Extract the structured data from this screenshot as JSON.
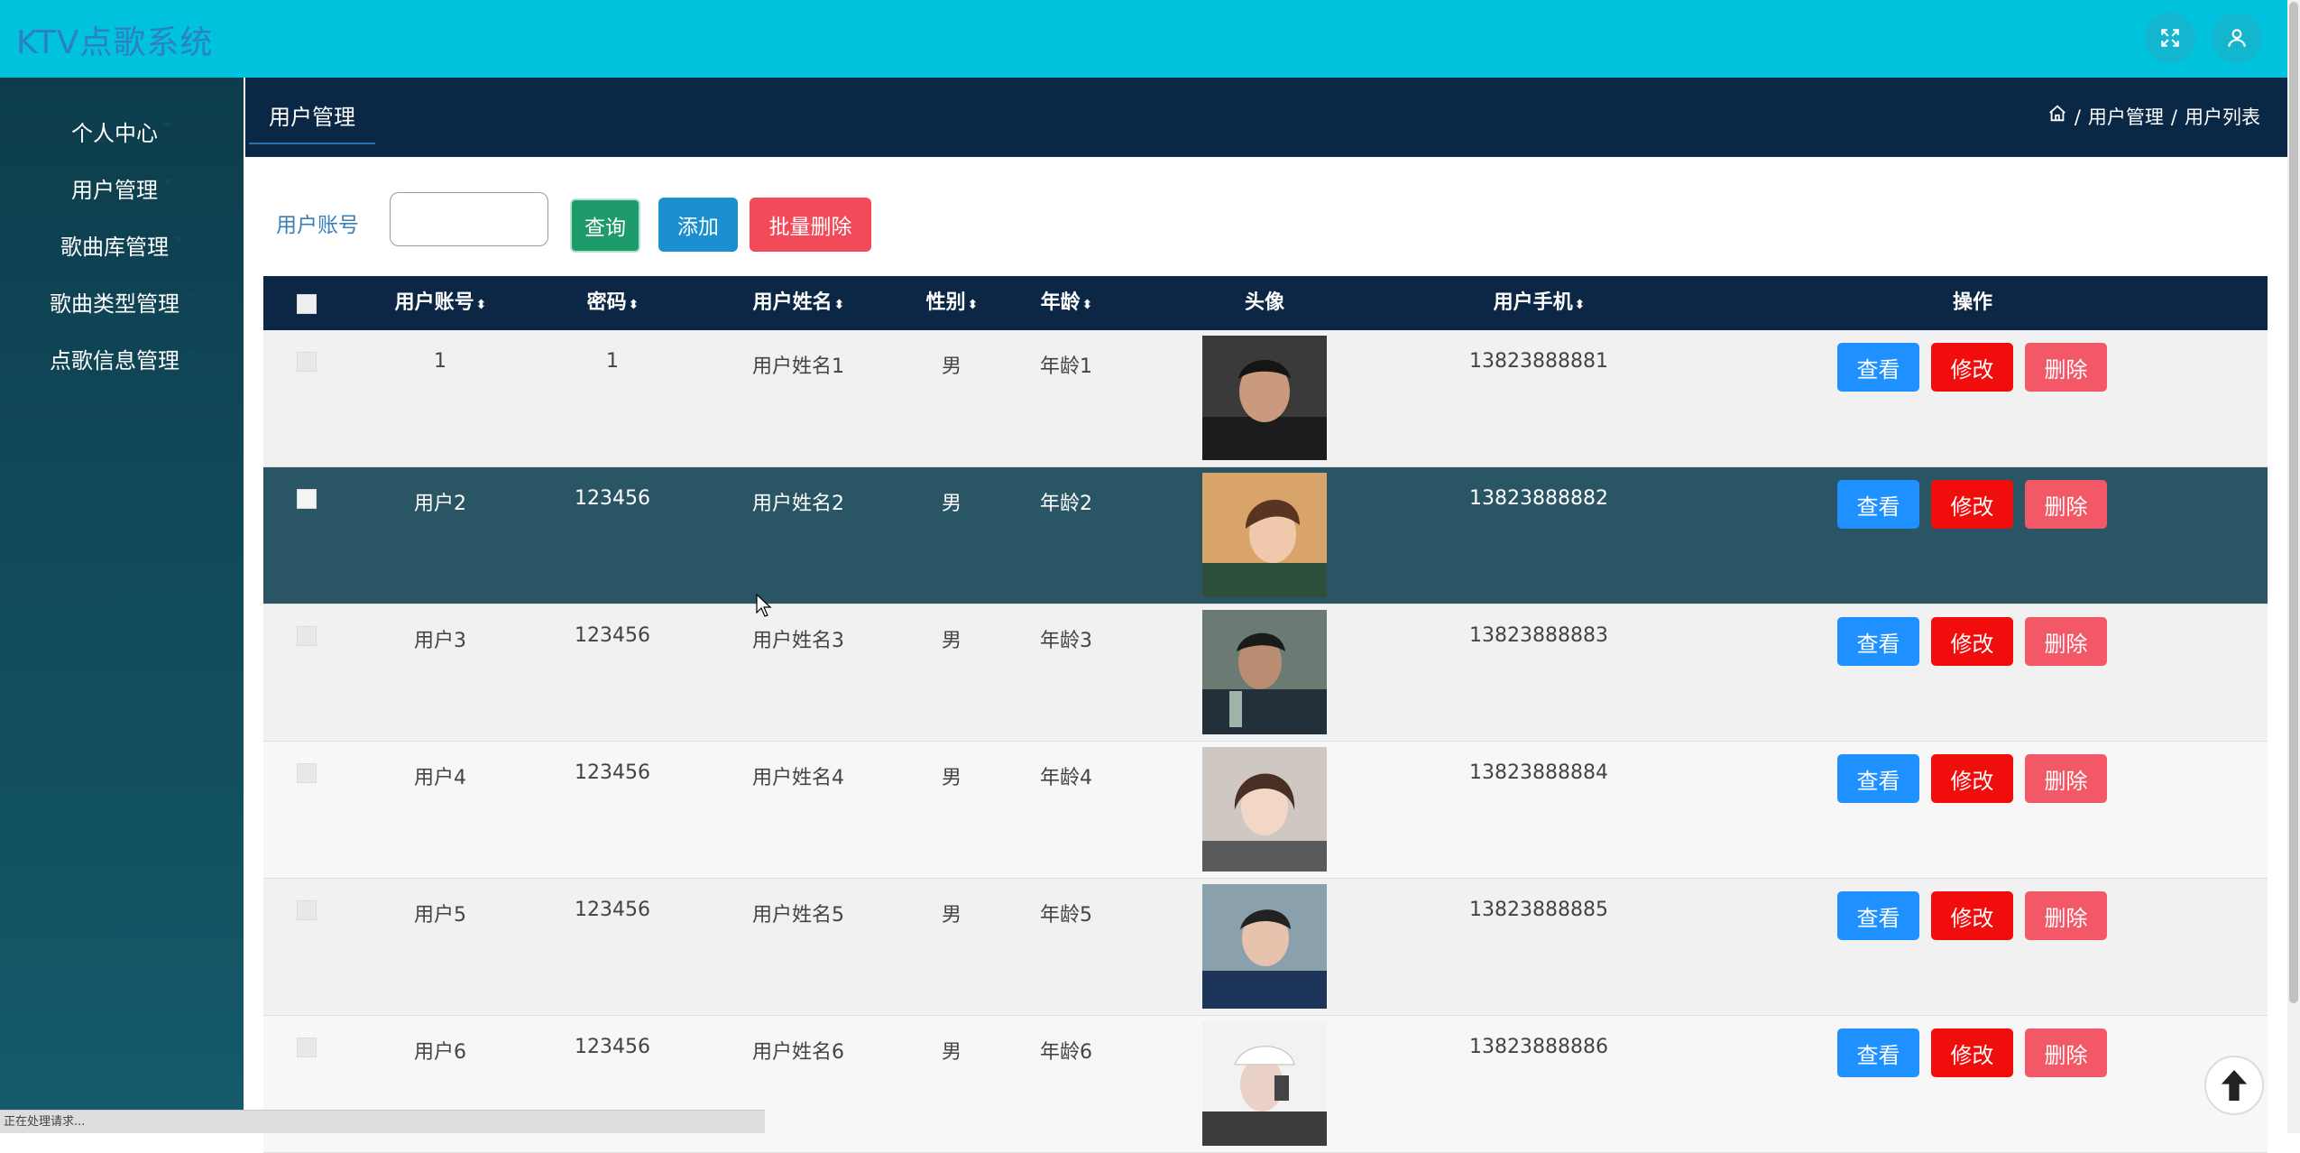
{
  "app": {
    "title": "KTV点歌系统"
  },
  "header": {
    "fullscreen_icon": "expand-icon",
    "user_icon": "user-icon"
  },
  "sidebar": {
    "items": [
      {
        "label": "个人中心"
      },
      {
        "label": "用户管理"
      },
      {
        "label": "歌曲库管理"
      },
      {
        "label": "歌曲类型管理"
      },
      {
        "label": "点歌信息管理"
      }
    ]
  },
  "page": {
    "tab": "用户管理",
    "breadcrumb": [
      "用户管理",
      "用户列表"
    ],
    "breadcrumb_sep": "/"
  },
  "search": {
    "label": "用户账号",
    "value": "",
    "query_button": "查询",
    "add_button": "添加",
    "bulk_delete_button": "批量删除"
  },
  "table": {
    "columns": [
      "用户账号",
      "密码",
      "用户姓名",
      "性别",
      "年龄",
      "头像",
      "用户手机",
      "操作"
    ],
    "sort_icon": "⬍",
    "actions": {
      "view": "查看",
      "edit": "修改",
      "delete": "删除"
    },
    "rows": [
      {
        "account": "1",
        "password": "1",
        "name": "用户姓名1",
        "gender": "男",
        "age": "年龄1",
        "phone": "13823888881"
      },
      {
        "account": "用户2",
        "password": "123456",
        "name": "用户姓名2",
        "gender": "男",
        "age": "年龄2",
        "phone": "13823888882"
      },
      {
        "account": "用户3",
        "password": "123456",
        "name": "用户姓名3",
        "gender": "男",
        "age": "年龄3",
        "phone": "13823888883"
      },
      {
        "account": "用户4",
        "password": "123456",
        "name": "用户姓名4",
        "gender": "男",
        "age": "年龄4",
        "phone": "13823888884"
      },
      {
        "account": "用户5",
        "password": "123456",
        "name": "用户姓名5",
        "gender": "男",
        "age": "年龄5",
        "phone": "13823888885"
      },
      {
        "account": "用户6",
        "password": "123456",
        "name": "用户姓名6",
        "gender": "男",
        "age": "年龄6",
        "phone": "13823888886"
      }
    ]
  },
  "status_bar": {
    "text": "正在处理请求..."
  },
  "colors": {
    "topbar": "#00c2dc",
    "sidebar": "#0d3d4d",
    "table_header": "#0b2745",
    "row_hover": "#295565",
    "view": "#1e90ff",
    "edit": "#f20d0d",
    "delete": "#f25866"
  }
}
